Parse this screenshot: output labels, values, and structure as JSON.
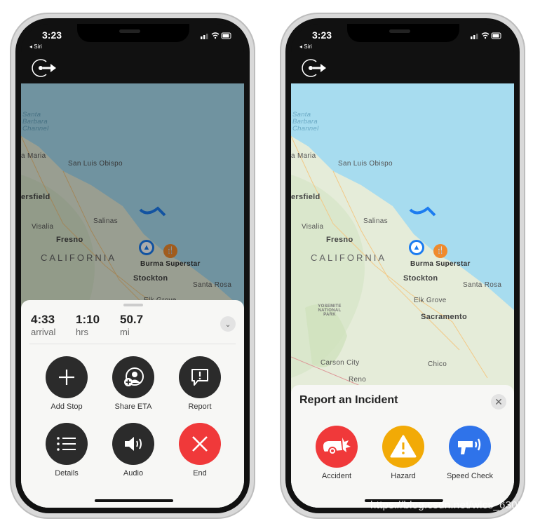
{
  "status_bar": {
    "time": "3:23",
    "back_app": "◂ Siri"
  },
  "map": {
    "labels": {
      "santa_barbara_channel": "Santa Barbara Channel",
      "santa_maria": "a Maria",
      "san_luis_obispo": "San Luis Obispo",
      "bakersfield": "ersfield",
      "salinas": "Salinas",
      "visalia": "Visalia",
      "fresno": "Fresno",
      "california": "CALIFORNIA",
      "destination": "Burma Superstar",
      "stockton": "Stockton",
      "santa_rosa": "Santa Rosa",
      "elk_grove": "Elk Grove",
      "sacramento": "Sacramento",
      "yosemite": "YOSEMITE NATIONAL PARK",
      "carson_city": "Carson City",
      "reno": "Reno",
      "chico": "Chico"
    }
  },
  "nav_sheet": {
    "arrival_value": "4:33",
    "arrival_label": "arrival",
    "duration_value": "1:10",
    "duration_label": "hrs",
    "distance_value": "50.7",
    "distance_label": "mi",
    "buttons": [
      {
        "label": "Add Stop",
        "icon": "plus-icon"
      },
      {
        "label": "Share ETA",
        "icon": "share-eta-icon"
      },
      {
        "label": "Report",
        "icon": "report-bubble-icon"
      },
      {
        "label": "Details",
        "icon": "list-icon"
      },
      {
        "label": "Audio",
        "icon": "speaker-icon"
      },
      {
        "label": "End",
        "icon": "x-icon"
      }
    ]
  },
  "incident_sheet": {
    "title": "Report an Incident",
    "options": [
      {
        "label": "Accident",
        "color": "#f0393a"
      },
      {
        "label": "Hazard",
        "color": "#f2aa06"
      },
      {
        "label": "Speed Check",
        "color": "#2f73ea"
      }
    ]
  },
  "colors": {
    "end_button": "#f0393a",
    "action_button": "#2b2b2b",
    "route": "#1c7cf0",
    "poi": "#f08a2c",
    "water": "#a7dcef",
    "land": "#e7eedf"
  },
  "watermark": "https://blog.csdn.net/wlcs_6305"
}
